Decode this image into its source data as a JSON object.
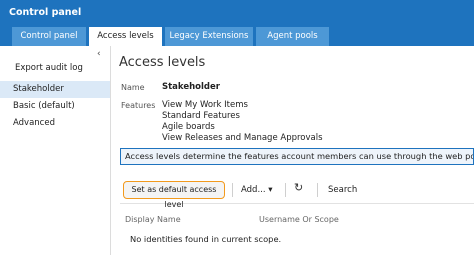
{
  "header": {
    "title": "Control panel"
  },
  "tabs": [
    {
      "label": "Control panel"
    },
    {
      "label": "Access levels"
    },
    {
      "label": "Legacy Extensions"
    },
    {
      "label": "Agent pools"
    }
  ],
  "sidebar": {
    "collapse_glyph": "‹",
    "export_label": "Export audit log",
    "items": [
      {
        "label": "Stakeholder"
      },
      {
        "label": "Basic (default)"
      },
      {
        "label": "Advanced"
      }
    ]
  },
  "main": {
    "heading": "Access levels",
    "name_label": "Name",
    "name_value": "Stakeholder",
    "features_label": "Features",
    "features": [
      "View My Work Items",
      "Standard Features",
      "Agile boards",
      "View Releases and Manage Approvals"
    ],
    "info_text": "Access levels determine the features account members can use through the web portal. For more",
    "toolbar": {
      "set_default_label": "Set as default access level",
      "add_label": "Add...",
      "add_caret": "▾",
      "refresh_glyph": "↻",
      "search_label": "Search"
    },
    "columns": [
      "Display Name",
      "Username Or Scope"
    ],
    "empty_message": "No identities found in current scope."
  }
}
